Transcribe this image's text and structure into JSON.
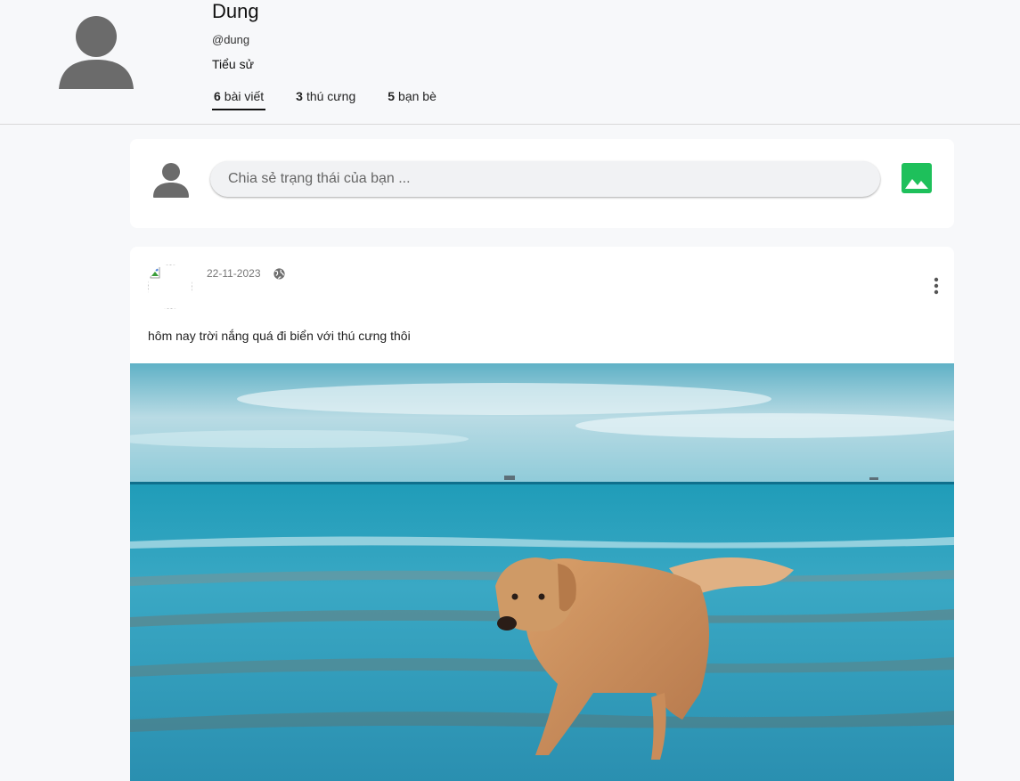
{
  "profile": {
    "name": "Dung",
    "handle": "@dung",
    "bio": "Tiểu sử",
    "stats": [
      {
        "count": "6",
        "label": "bài viết",
        "active": true
      },
      {
        "count": "3",
        "label": "thú cưng",
        "active": false
      },
      {
        "count": "5",
        "label": "bạn bè",
        "active": false
      }
    ]
  },
  "composer": {
    "placeholder": "Chia sẻ trạng thái của bạn ...",
    "image_icon": "image-icon",
    "accent": "#1ec05b"
  },
  "post": {
    "date": "22-11-2023",
    "visibility_icon": "globe-icon",
    "text": "hôm nay trời nắng quá đi biển với thú cưng thôi"
  }
}
